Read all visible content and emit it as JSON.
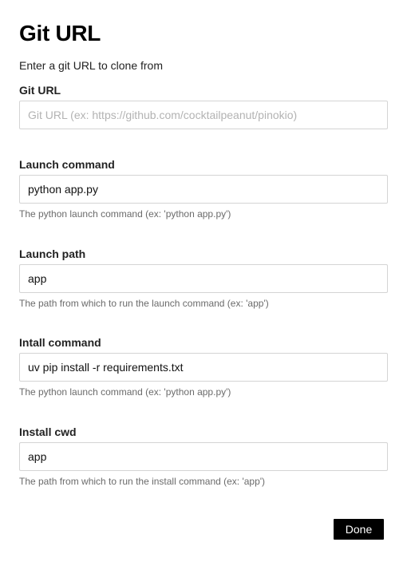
{
  "page": {
    "title": "Git URL",
    "subtitle": "Enter a git URL to clone from"
  },
  "fields": {
    "git_url": {
      "label": "Git URL",
      "value": "",
      "placeholder": "Git URL (ex: https://github.com/cocktailpeanut/pinokio)"
    },
    "launch_command": {
      "label": "Launch command",
      "value": "python app.py",
      "help": "The python launch command (ex: 'python app.py')"
    },
    "launch_path": {
      "label": "Launch path",
      "value": "app",
      "help": "The path from which to run the launch command (ex: 'app')"
    },
    "install_command": {
      "label": "Intall command",
      "value": "uv pip install -r requirements.txt",
      "help": "The python launch command (ex: 'python app.py')"
    },
    "install_cwd": {
      "label": "Install cwd",
      "value": "app",
      "help": "The path from which to run the install command (ex: 'app')"
    }
  },
  "actions": {
    "done_label": "Done"
  }
}
